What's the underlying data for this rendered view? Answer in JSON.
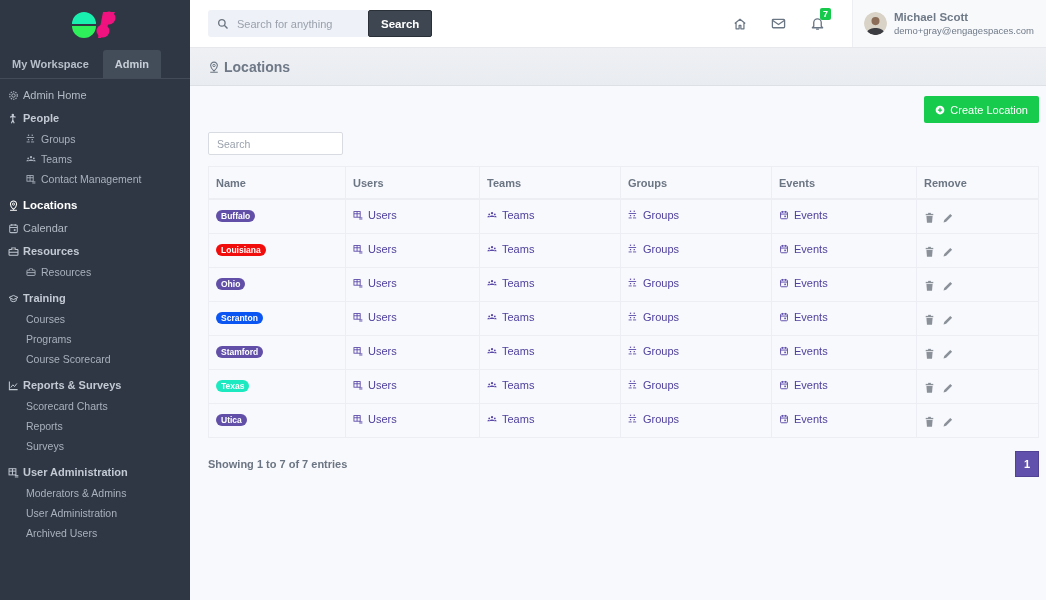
{
  "sidebar": {
    "tabs": [
      {
        "label": "My Workspace",
        "selected": false
      },
      {
        "label": "Admin",
        "selected": true
      }
    ],
    "items": [
      {
        "label": "Admin Home",
        "selected": false,
        "kind": "link"
      },
      {
        "label": "People",
        "selected": false,
        "kind": "section",
        "children": [
          {
            "label": "Groups"
          },
          {
            "label": "Teams"
          },
          {
            "label": "Contact Management"
          }
        ]
      },
      {
        "label": "Locations",
        "selected": true,
        "kind": "link"
      },
      {
        "label": "Calendar",
        "selected": false,
        "kind": "link"
      },
      {
        "label": "Resources",
        "selected": false,
        "kind": "section",
        "children": [
          {
            "label": "Resources"
          }
        ]
      },
      {
        "label": "Training",
        "selected": false,
        "kind": "section",
        "children": [
          {
            "label": "Courses"
          },
          {
            "label": "Programs"
          },
          {
            "label": "Course Scorecard"
          }
        ]
      },
      {
        "label": "Reports & Surveys",
        "selected": false,
        "kind": "section",
        "children": [
          {
            "label": "Scorecard Charts"
          },
          {
            "label": "Reports"
          },
          {
            "label": "Surveys"
          }
        ]
      },
      {
        "label": "User Administration",
        "selected": false,
        "kind": "section",
        "children": [
          {
            "label": "Moderators & Admins"
          },
          {
            "label": "User Administration"
          },
          {
            "label": "Archived Users"
          }
        ]
      }
    ]
  },
  "header": {
    "search": {
      "placeholder": "Search for anything"
    },
    "search_button": "Search",
    "notification_count": "7",
    "user": {
      "name": "Michael Scott",
      "email": "demo+gray@engagespaces.com"
    }
  },
  "page": {
    "title": "Locations",
    "create_button": "Create Location",
    "search": {
      "placeholder": "Search"
    },
    "table": {
      "columns": [
        "Name",
        "Users",
        "Teams",
        "Groups",
        "Events",
        "Remove"
      ],
      "rows": [
        {
          "name": "Buffalo",
          "color": "#6250a8",
          "users": "Users",
          "teams": "Teams",
          "groups": "Groups",
          "events": "Events"
        },
        {
          "name": "Louisiana",
          "color": "#f20d0d",
          "users": "Users",
          "teams": "Teams",
          "groups": "Groups",
          "events": "Events"
        },
        {
          "name": "Ohio",
          "color": "#6250a8",
          "users": "Users",
          "teams": "Teams",
          "groups": "Groups",
          "events": "Events"
        },
        {
          "name": "Scranton",
          "color": "#0b55f2",
          "users": "Users",
          "teams": "Teams",
          "groups": "Groups",
          "events": "Events"
        },
        {
          "name": "Stamford",
          "color": "#6250a8",
          "users": "Users",
          "teams": "Teams",
          "groups": "Groups",
          "events": "Events"
        },
        {
          "name": "Texas",
          "color": "#1de9c0",
          "users": "Users",
          "teams": "Teams",
          "groups": "Groups",
          "events": "Events"
        },
        {
          "name": "Utica",
          "color": "#6250a8",
          "users": "Users",
          "teams": "Teams",
          "groups": "Groups",
          "events": "Events"
        }
      ]
    },
    "footer": "Showing 1 to 7 of 7 entries",
    "pagination": [
      {
        "label": "1",
        "selected": true
      }
    ]
  }
}
